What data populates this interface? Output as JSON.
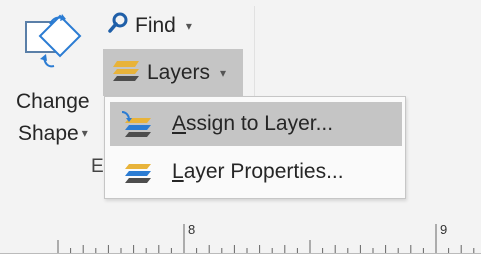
{
  "ribbon": {
    "change_shape": {
      "line1": "Change",
      "line2": "Shape"
    },
    "group_label_fragment": "E",
    "find": {
      "label": "Find"
    },
    "layers": {
      "label": "Layers"
    }
  },
  "layers_menu": {
    "items": [
      {
        "prefix": "",
        "mnemonic": "A",
        "rest": "ssign to Layer...",
        "highlighted": true
      },
      {
        "prefix": "",
        "mnemonic": "L",
        "rest": "ayer Properties...",
        "highlighted": false
      }
    ]
  },
  "ruler": {
    "labels": [
      "8",
      "9"
    ]
  },
  "icons": {
    "change_shape": "change-shape-icon",
    "find": "magnifier-icon",
    "layers": "layers-icon",
    "assign_to_layer": "assign-layer-icon",
    "layer_properties": "layer-properties-icon"
  },
  "colors": {
    "pressed": "#c5c5c5",
    "menu_bg": "#fafafa",
    "ribbon_bg": "#f3f3f3",
    "accent_blue": "#2b7cd3",
    "layer_yellow": "#e8b33a",
    "layer_gray": "#4d4d4d"
  }
}
